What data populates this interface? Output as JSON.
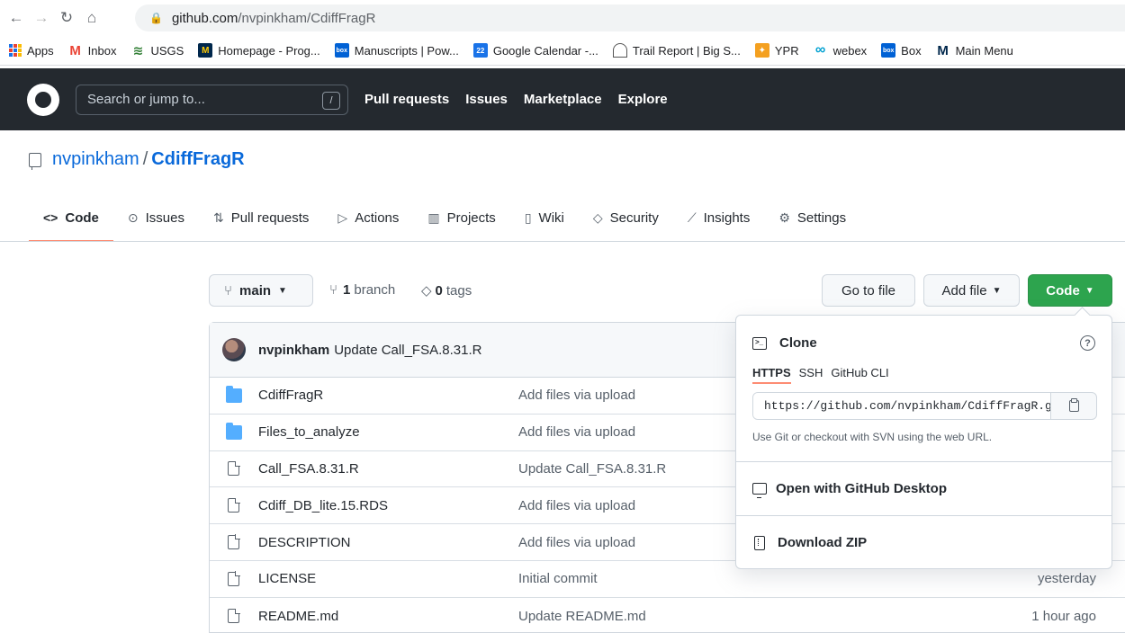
{
  "browser": {
    "url_host": "github.com",
    "url_path": "/nvpinkham/CdiffFragR"
  },
  "bookmarks": [
    {
      "label": "Apps",
      "icon": "apps-grid-icon"
    },
    {
      "label": "Inbox",
      "icon": "gmail-icon"
    },
    {
      "label": "USGS",
      "icon": "usgs-icon"
    },
    {
      "label": "Homepage - Prog...",
      "icon": "umich-icon"
    },
    {
      "label": "Manuscripts | Pow...",
      "icon": "box-icon"
    },
    {
      "label": "Google Calendar -...",
      "icon": "calendar-icon"
    },
    {
      "label": "Trail Report | Big S...",
      "icon": "trail-icon"
    },
    {
      "label": "YPR",
      "icon": "ypr-icon"
    },
    {
      "label": "webex",
      "icon": "webex-icon"
    },
    {
      "label": "Box",
      "icon": "box-icon"
    },
    {
      "label": "Main Menu",
      "icon": "umich-icon"
    }
  ],
  "bookmark_glyphs": {
    "box": "box",
    "calendar": "22",
    "umich": "M"
  },
  "gh_header": {
    "search_placeholder": "Search or jump to...",
    "slash_key": "/",
    "nav": [
      "Pull requests",
      "Issues",
      "Marketplace",
      "Explore"
    ]
  },
  "repo": {
    "owner": "nvpinkham",
    "separator": "/",
    "name": "CdiffFragR"
  },
  "tabs": [
    {
      "label": "Code",
      "icon": "code-icon",
      "glyph": "<>",
      "active": true
    },
    {
      "label": "Issues",
      "icon": "issue-icon",
      "glyph": "⊙",
      "active": false
    },
    {
      "label": "Pull requests",
      "icon": "pull-request-icon",
      "glyph": "⇅",
      "active": false
    },
    {
      "label": "Actions",
      "icon": "actions-play-icon",
      "glyph": "▷",
      "active": false
    },
    {
      "label": "Projects",
      "icon": "projects-icon",
      "glyph": "▥",
      "active": false
    },
    {
      "label": "Wiki",
      "icon": "book-icon",
      "glyph": "▯",
      "active": false
    },
    {
      "label": "Security",
      "icon": "shield-icon",
      "glyph": "◇",
      "active": false
    },
    {
      "label": "Insights",
      "icon": "graph-icon",
      "glyph": "⟋",
      "active": false
    },
    {
      "label": "Settings",
      "icon": "gear-icon",
      "glyph": "⚙",
      "active": false
    }
  ],
  "branch": {
    "current": "main",
    "branch_count": "1",
    "branch_word": "branch",
    "tag_count": "0",
    "tag_word": "tags"
  },
  "buttons": {
    "go_to_file": "Go to file",
    "add_file": "Add file",
    "code": "Code"
  },
  "latest_commit": {
    "author": "nvpinkham",
    "message": "Update Call_FSA.8.31.R"
  },
  "files": [
    {
      "name": "CdiffFragR",
      "type": "folder",
      "message": "Add files via upload",
      "date": ""
    },
    {
      "name": "Files_to_analyze",
      "type": "folder",
      "message": "Add files via upload",
      "date": ""
    },
    {
      "name": "Call_FSA.8.31.R",
      "type": "file",
      "message": "Update Call_FSA.8.31.R",
      "date": ""
    },
    {
      "name": "Cdiff_DB_lite.15.RDS",
      "type": "file",
      "message": "Add files via upload",
      "date": ""
    },
    {
      "name": "DESCRIPTION",
      "type": "file",
      "message": "Add files via upload",
      "date": ""
    },
    {
      "name": "LICENSE",
      "type": "file",
      "message": "Initial commit",
      "date": "yesterday"
    },
    {
      "name": "README.md",
      "type": "file",
      "message": "Update README.md",
      "date": "1 hour ago"
    }
  ],
  "clone_panel": {
    "title": "Clone",
    "help": "?",
    "terminal_glyph": ">_",
    "tabs": [
      {
        "label": "HTTPS",
        "active": true
      },
      {
        "label": "SSH",
        "active": false
      },
      {
        "label": "GitHub CLI",
        "active": false
      }
    ],
    "url_value": "https://github.com/nvpinkham/CdiffFragR.git",
    "hint": "Use Git or checkout with SVN using the web URL.",
    "open_desktop": "Open with GitHub Desktop",
    "download_zip": "Download ZIP"
  },
  "colors": {
    "header_bg": "#24292f",
    "link_blue": "#0969da",
    "code_button_green": "#2da44e",
    "active_tab_underline": "#fd8c73",
    "folder_blue": "#54aeff"
  }
}
